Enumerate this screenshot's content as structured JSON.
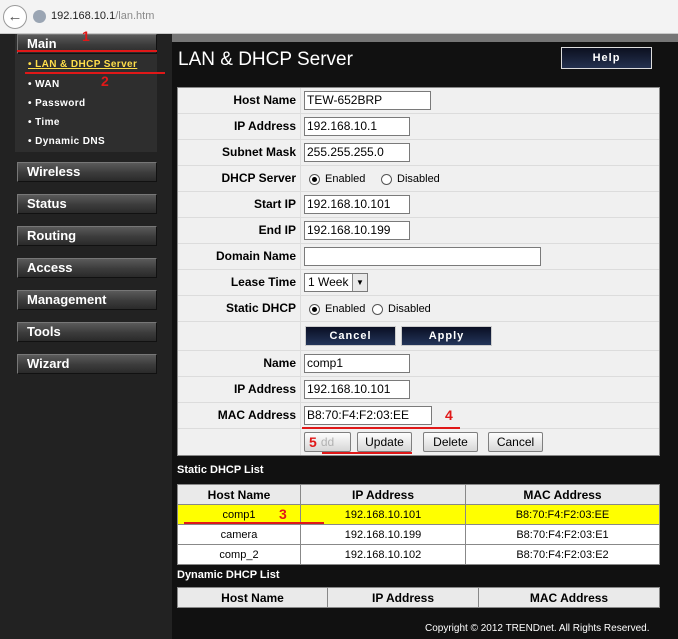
{
  "browser": {
    "url_host": "192.168.10.1",
    "url_path": "/lan.htm",
    "back_icon": "←"
  },
  "sidebar": {
    "main": "Main",
    "subitems": [
      {
        "label": "LAN & DHCP Server",
        "active": true
      },
      {
        "label": "WAN"
      },
      {
        "label": "Password"
      },
      {
        "label": "Time"
      },
      {
        "label": "Dynamic DNS"
      }
    ],
    "nav": [
      "Wireless",
      "Status",
      "Routing",
      "Access",
      "Management",
      "Tools",
      "Wizard"
    ]
  },
  "page": {
    "title": "LAN & DHCP Server",
    "help": "Help"
  },
  "form": {
    "host_name": {
      "label": "Host Name",
      "value": "TEW-652BRP"
    },
    "ip_address": {
      "label": "IP Address",
      "value": "192.168.10.1"
    },
    "subnet_mask": {
      "label": "Subnet Mask",
      "value": "255.255.255.0"
    },
    "dhcp_server": {
      "label": "DHCP Server",
      "enabled": "Enabled",
      "disabled": "Disabled",
      "selected": "Enabled"
    },
    "start_ip": {
      "label": "Start IP",
      "value": "192.168.10.101"
    },
    "end_ip": {
      "label": "End IP",
      "value": "192.168.10.199"
    },
    "domain_name": {
      "label": "Domain Name",
      "value": ""
    },
    "lease_time": {
      "label": "Lease Time",
      "value": "1 Week"
    },
    "static_dhcp": {
      "label": "Static DHCP",
      "enabled": "Enabled",
      "disabled": "Disabled",
      "selected": "Enabled"
    },
    "cancel": "Cancel",
    "apply": "Apply",
    "static_name": {
      "label": "Name",
      "value": "comp1"
    },
    "static_ip": {
      "label": "IP Address",
      "value": "192.168.10.101"
    },
    "static_mac": {
      "label": "MAC Address",
      "value": "B8:70:F4:F2:03:EE"
    },
    "add": "dd",
    "update": "Update",
    "delete": "Delete",
    "cancel2": "Cancel"
  },
  "static_list": {
    "title": "Static DHCP List",
    "headers": [
      "Host Name",
      "IP Address",
      "MAC Address"
    ],
    "rows": [
      [
        "comp1",
        "192.168.10.101",
        "B8:70:F4:F2:03:EE"
      ],
      [
        "camera",
        "192.168.10.199",
        "B8:70:F4:F2:03:E1"
      ],
      [
        "comp_2",
        "192.168.10.102",
        "B8:70:F4:F2:03:E2"
      ]
    ]
  },
  "dynamic_list": {
    "title": "Dynamic DHCP List",
    "headers": [
      "Host Name",
      "IP Address",
      "MAC Address"
    ]
  },
  "annotations": [
    "1",
    "2",
    "3",
    "4",
    "5"
  ],
  "footer": "Copyright © 2012 TRENDnet. All Rights Reserved.",
  "colors": {
    "highlight": "#ffff00",
    "annotation": "#e01818",
    "active_subitem": "#ffde4a"
  }
}
